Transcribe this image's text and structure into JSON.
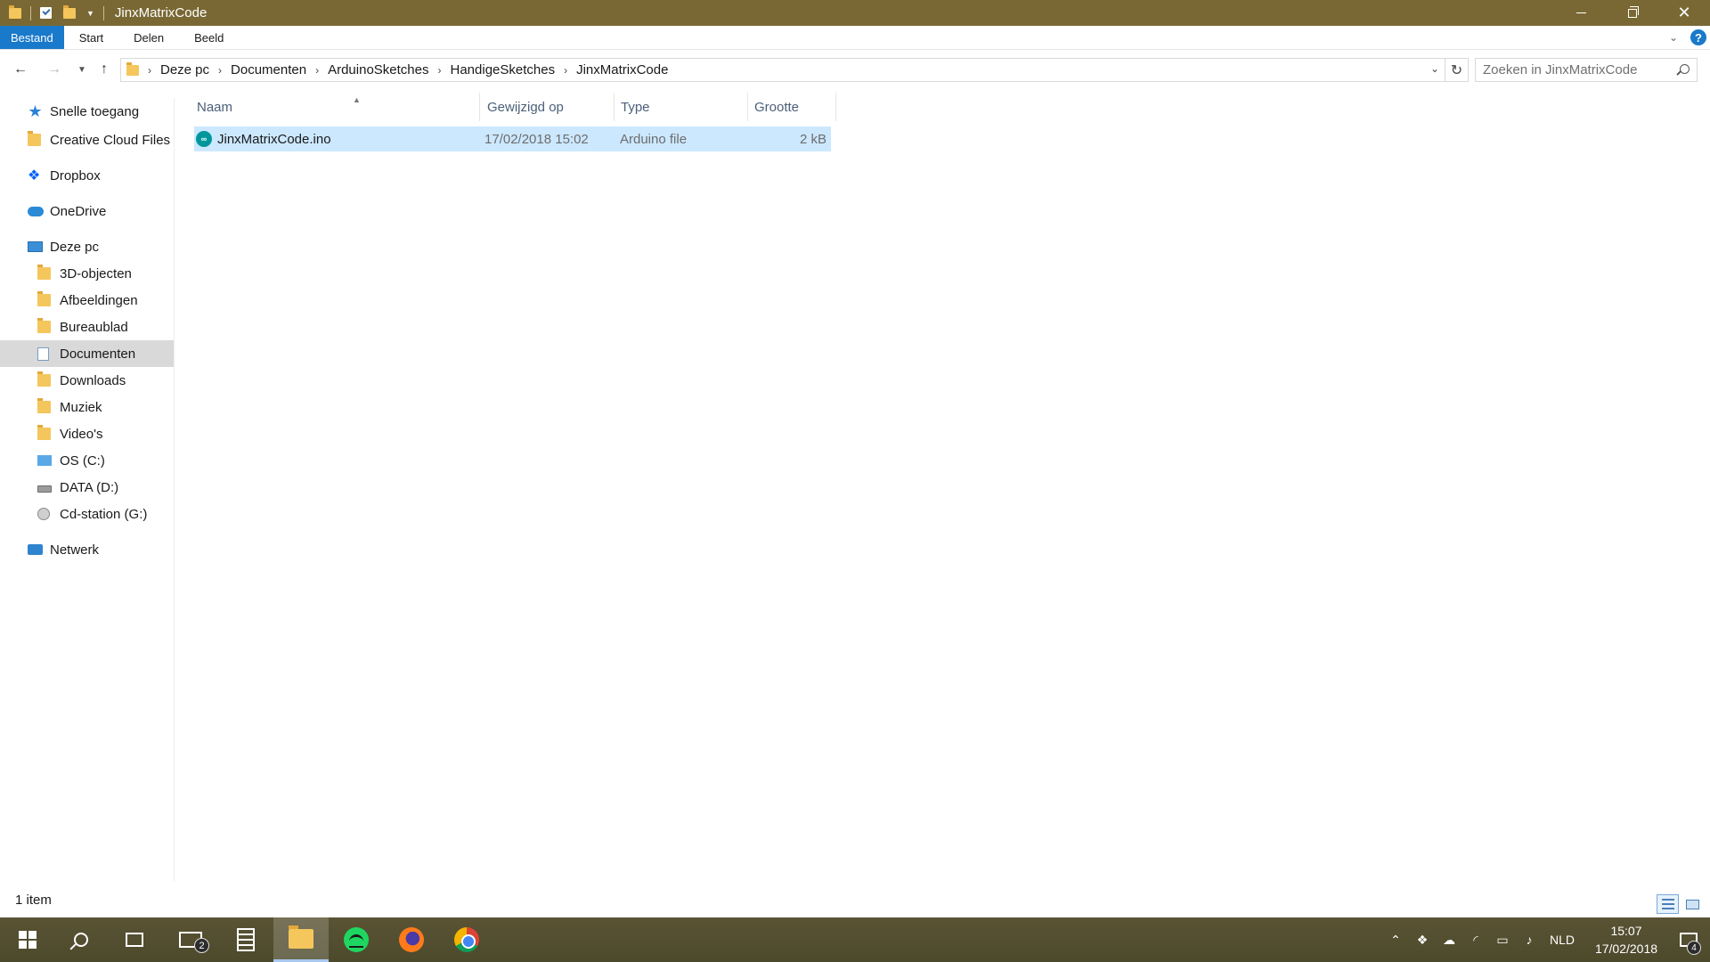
{
  "window": {
    "title": "JinxMatrixCode",
    "accent_color": "#7a6834"
  },
  "ribbon": {
    "tabs": [
      {
        "label": "Bestand"
      },
      {
        "label": "Start"
      },
      {
        "label": "Delen"
      },
      {
        "label": "Beeld"
      }
    ],
    "help_label": "?"
  },
  "address": {
    "breadcrumbs": [
      "Deze pc",
      "Documenten",
      "ArduinoSketches",
      "HandigeSketches",
      "JinxMatrixCode"
    ]
  },
  "search": {
    "placeholder": "Zoeken in JinxMatrixCode"
  },
  "sidebar": {
    "items": [
      {
        "label": "Snelle toegang",
        "icon": "star-icon"
      },
      {
        "label": "Creative Cloud Files",
        "icon": "folder-icon"
      },
      {
        "label": "Dropbox",
        "icon": "dropbox-icon"
      },
      {
        "label": "OneDrive",
        "icon": "cloud-icon"
      },
      {
        "label": "Deze pc",
        "icon": "computer-icon"
      },
      {
        "label": "3D-objecten",
        "icon": "folder-icon"
      },
      {
        "label": "Afbeeldingen",
        "icon": "folder-icon"
      },
      {
        "label": "Bureaublad",
        "icon": "folder-icon"
      },
      {
        "label": "Documenten",
        "icon": "documents-icon",
        "selected": true
      },
      {
        "label": "Downloads",
        "icon": "folder-icon"
      },
      {
        "label": "Muziek",
        "icon": "folder-icon"
      },
      {
        "label": "Video's",
        "icon": "folder-icon"
      },
      {
        "label": "OS (C:)",
        "icon": "drive-icon"
      },
      {
        "label": "DATA (D:)",
        "icon": "drive-icon"
      },
      {
        "label": "Cd-station (G:)",
        "icon": "cd-drive-icon"
      },
      {
        "label": "Netwerk",
        "icon": "network-icon"
      }
    ]
  },
  "filelist": {
    "columns": [
      {
        "label": "Naam"
      },
      {
        "label": "Gewijzigd op"
      },
      {
        "label": "Type"
      },
      {
        "label": "Grootte"
      }
    ],
    "sorted_column": "Naam",
    "rows": [
      {
        "name": "JinxMatrixCode.ino",
        "modified": "17/02/2018 15:02",
        "type": "Arduino file",
        "size": "2 kB",
        "icon": "arduino-file-icon",
        "selected": true
      }
    ]
  },
  "status": {
    "item_count": "1 item"
  },
  "taskbar": {
    "mail_badge": "2",
    "language": "NLD",
    "time": "15:07",
    "date": "17/02/2018",
    "notification_badge": "4"
  }
}
